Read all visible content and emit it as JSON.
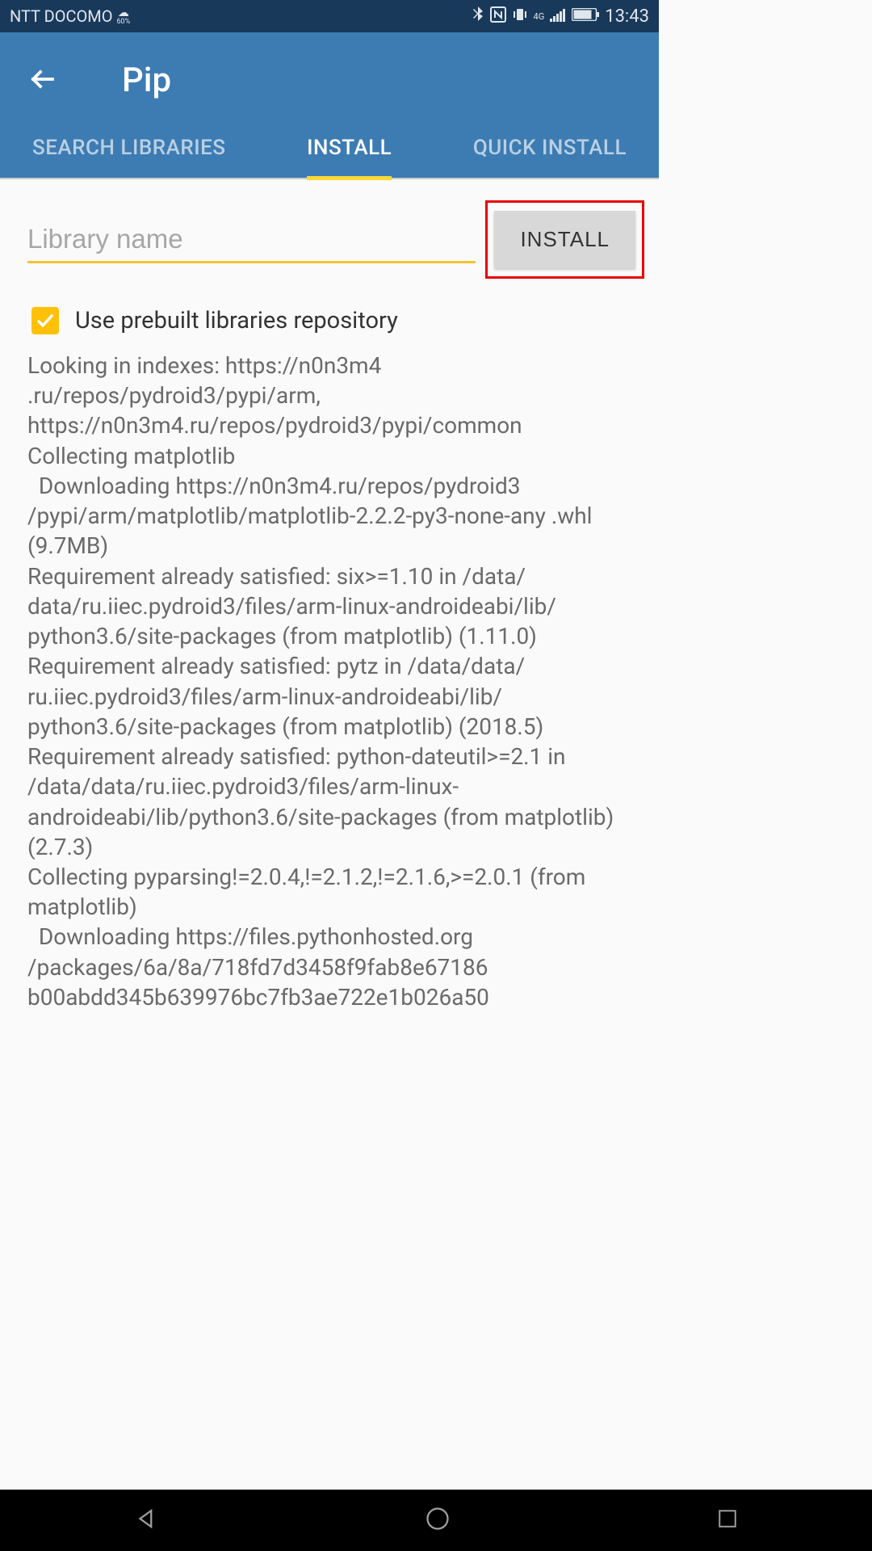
{
  "status_bar": {
    "carrier": "NTT DOCOMO",
    "weather_pct": "60%",
    "time": "13:43",
    "signal_type": "4G"
  },
  "app_bar": {
    "title": "Pip"
  },
  "tabs": [
    {
      "label": "SEARCH LIBRARIES",
      "active": false
    },
    {
      "label": "INSTALL",
      "active": true
    },
    {
      "label": "QUICK INSTALL",
      "active": false
    }
  ],
  "install_panel": {
    "input_placeholder": "Library name",
    "input_value": "",
    "install_button_label": "INSTALL",
    "checkbox_checked": true,
    "checkbox_label": "Use prebuilt libraries repository",
    "log_text": "Looking in indexes: https://n0n3m4 .ru/repos/pydroid3/pypi/arm, https://n0n3m4.ru/repos/pydroid3/pypi/common\nCollecting matplotlib\n  Downloading https://n0n3m4.ru/repos/pydroid3 /pypi/arm/matplotlib/matplotlib-2.2.2-py3-none-any .whl (9.7MB)\nRequirement already satisfied: six>=1.10 in /data/ data/ru.iiec.pydroid3/files/arm-linux-androideabi/lib/ python3.6/site-packages (from matplotlib) (1.11.0)\nRequirement already satisfied: pytz in /data/data/ ru.iiec.pydroid3/files/arm-linux-androideabi/lib/ python3.6/site-packages (from matplotlib) (2018.5)\nRequirement already satisfied: python-dateutil>=2.1 in /data/data/ru.iiec.pydroid3/files/arm-linux-androideabi/lib/python3.6/site-packages (from matplotlib) (2.7.3)\nCollecting pyparsing!=2.0.4,!=2.1.2,!=2.1.6,>=2.0.1 (from matplotlib)\n  Downloading https://files.pythonhosted.org /packages/6a/8a/718fd7d3458f9fab8e67186 b00abdd345b639976bc7fb3ae722e1b026a50"
  }
}
